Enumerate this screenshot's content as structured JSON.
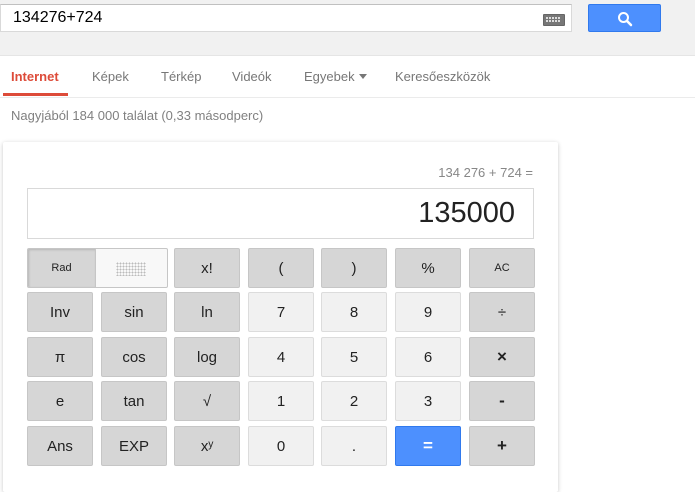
{
  "search": {
    "query": "134276+724"
  },
  "tabs": [
    {
      "label": "Internet"
    },
    {
      "label": "Képek"
    },
    {
      "label": "Térkép"
    },
    {
      "label": "Videók"
    },
    {
      "label": "Egyebek"
    },
    {
      "label": "Keresőeszközök"
    }
  ],
  "result_stats": "Nagyjából 184 000 találat (0,33 másodperc)",
  "calculator": {
    "history": "134 276 + 724 =",
    "result": "135000",
    "rad_label": "Rad",
    "keys": {
      "fact": "x!",
      "lparen": "(",
      "rparen": ")",
      "percent": "%",
      "ac": "AC",
      "inv": "Inv",
      "sin": "sin",
      "ln": "ln",
      "seven": "7",
      "eight": "8",
      "nine": "9",
      "divide": "÷",
      "pi": "π",
      "cos": "cos",
      "log": "log",
      "four": "4",
      "five": "5",
      "six": "6",
      "multiply": "×",
      "e": "e",
      "tan": "tan",
      "sqrt": "√",
      "one": "1",
      "two": "2",
      "three": "3",
      "minus": "-",
      "ans": "Ans",
      "exp": "EXP",
      "power": "xʸ",
      "zero": "0",
      "dot": ".",
      "equals": "=",
      "plus": "+"
    }
  },
  "colors": {
    "accent_red": "#dd4b39",
    "search_blue": "#4d90fe"
  }
}
